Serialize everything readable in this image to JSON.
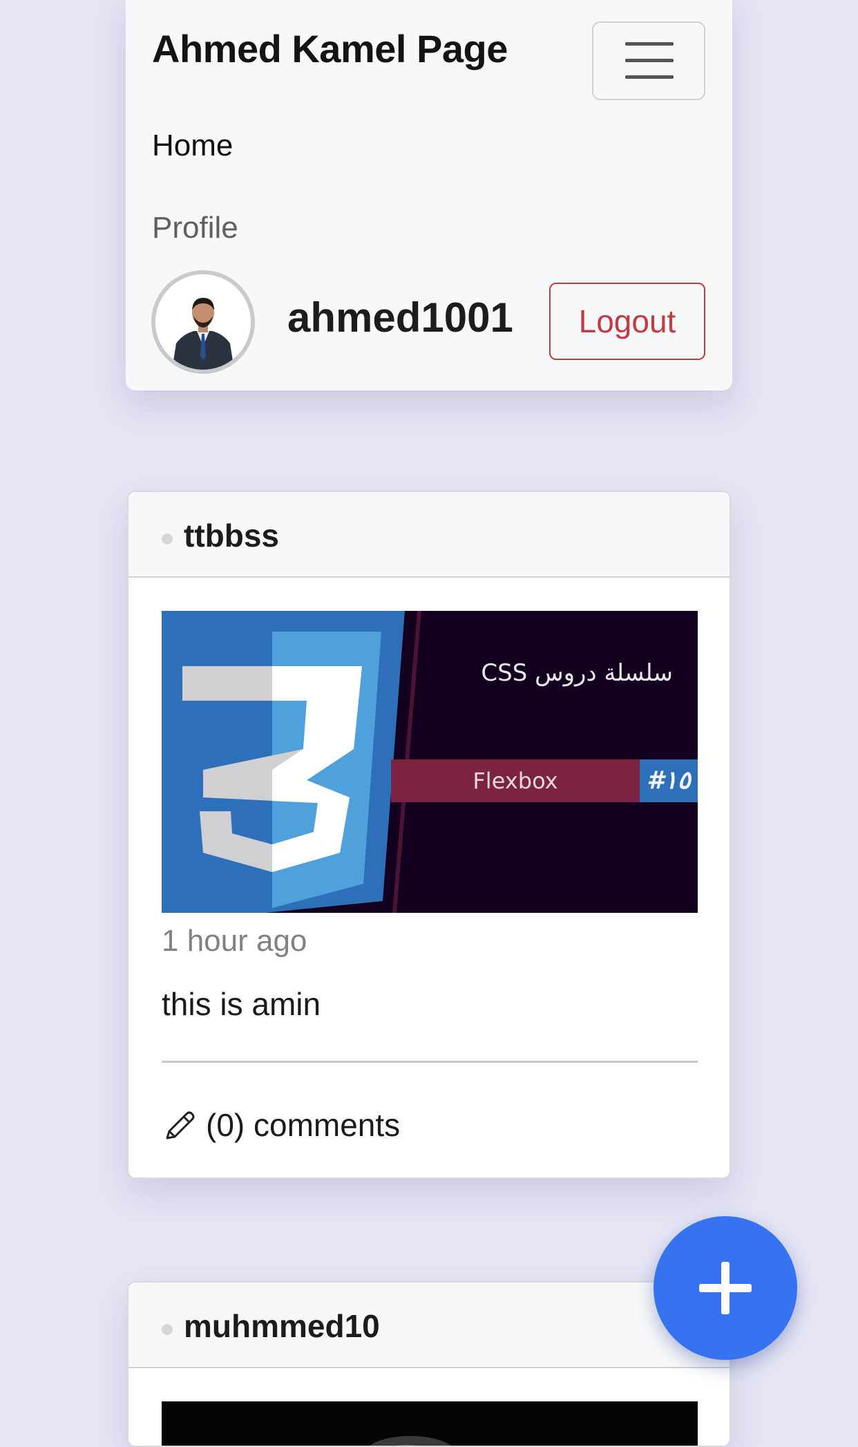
{
  "navbar": {
    "brand": "Ahmed Kamel Page",
    "links": [
      {
        "label": "Home"
      },
      {
        "label": "Profile"
      }
    ],
    "user": {
      "username": "ahmed1001",
      "logout_label": "Logout"
    }
  },
  "posts": [
    {
      "author": "ttbbss",
      "image": {
        "title": "سلسلة دروس CSS",
        "band": "Flexbox",
        "tag": "#١٥"
      },
      "time": "1 hour ago",
      "body": "this is amin",
      "comments_label": "(0) comments"
    },
    {
      "author": "muhmmed10"
    }
  ],
  "fab": {
    "icon": "plus-icon"
  },
  "colors": {
    "background": "#e6e5f5",
    "navbar_bg": "#f7f8f9",
    "logout": "#c53a40",
    "fab": "#3773f0",
    "css_logo_blue": "#2e6fba"
  }
}
